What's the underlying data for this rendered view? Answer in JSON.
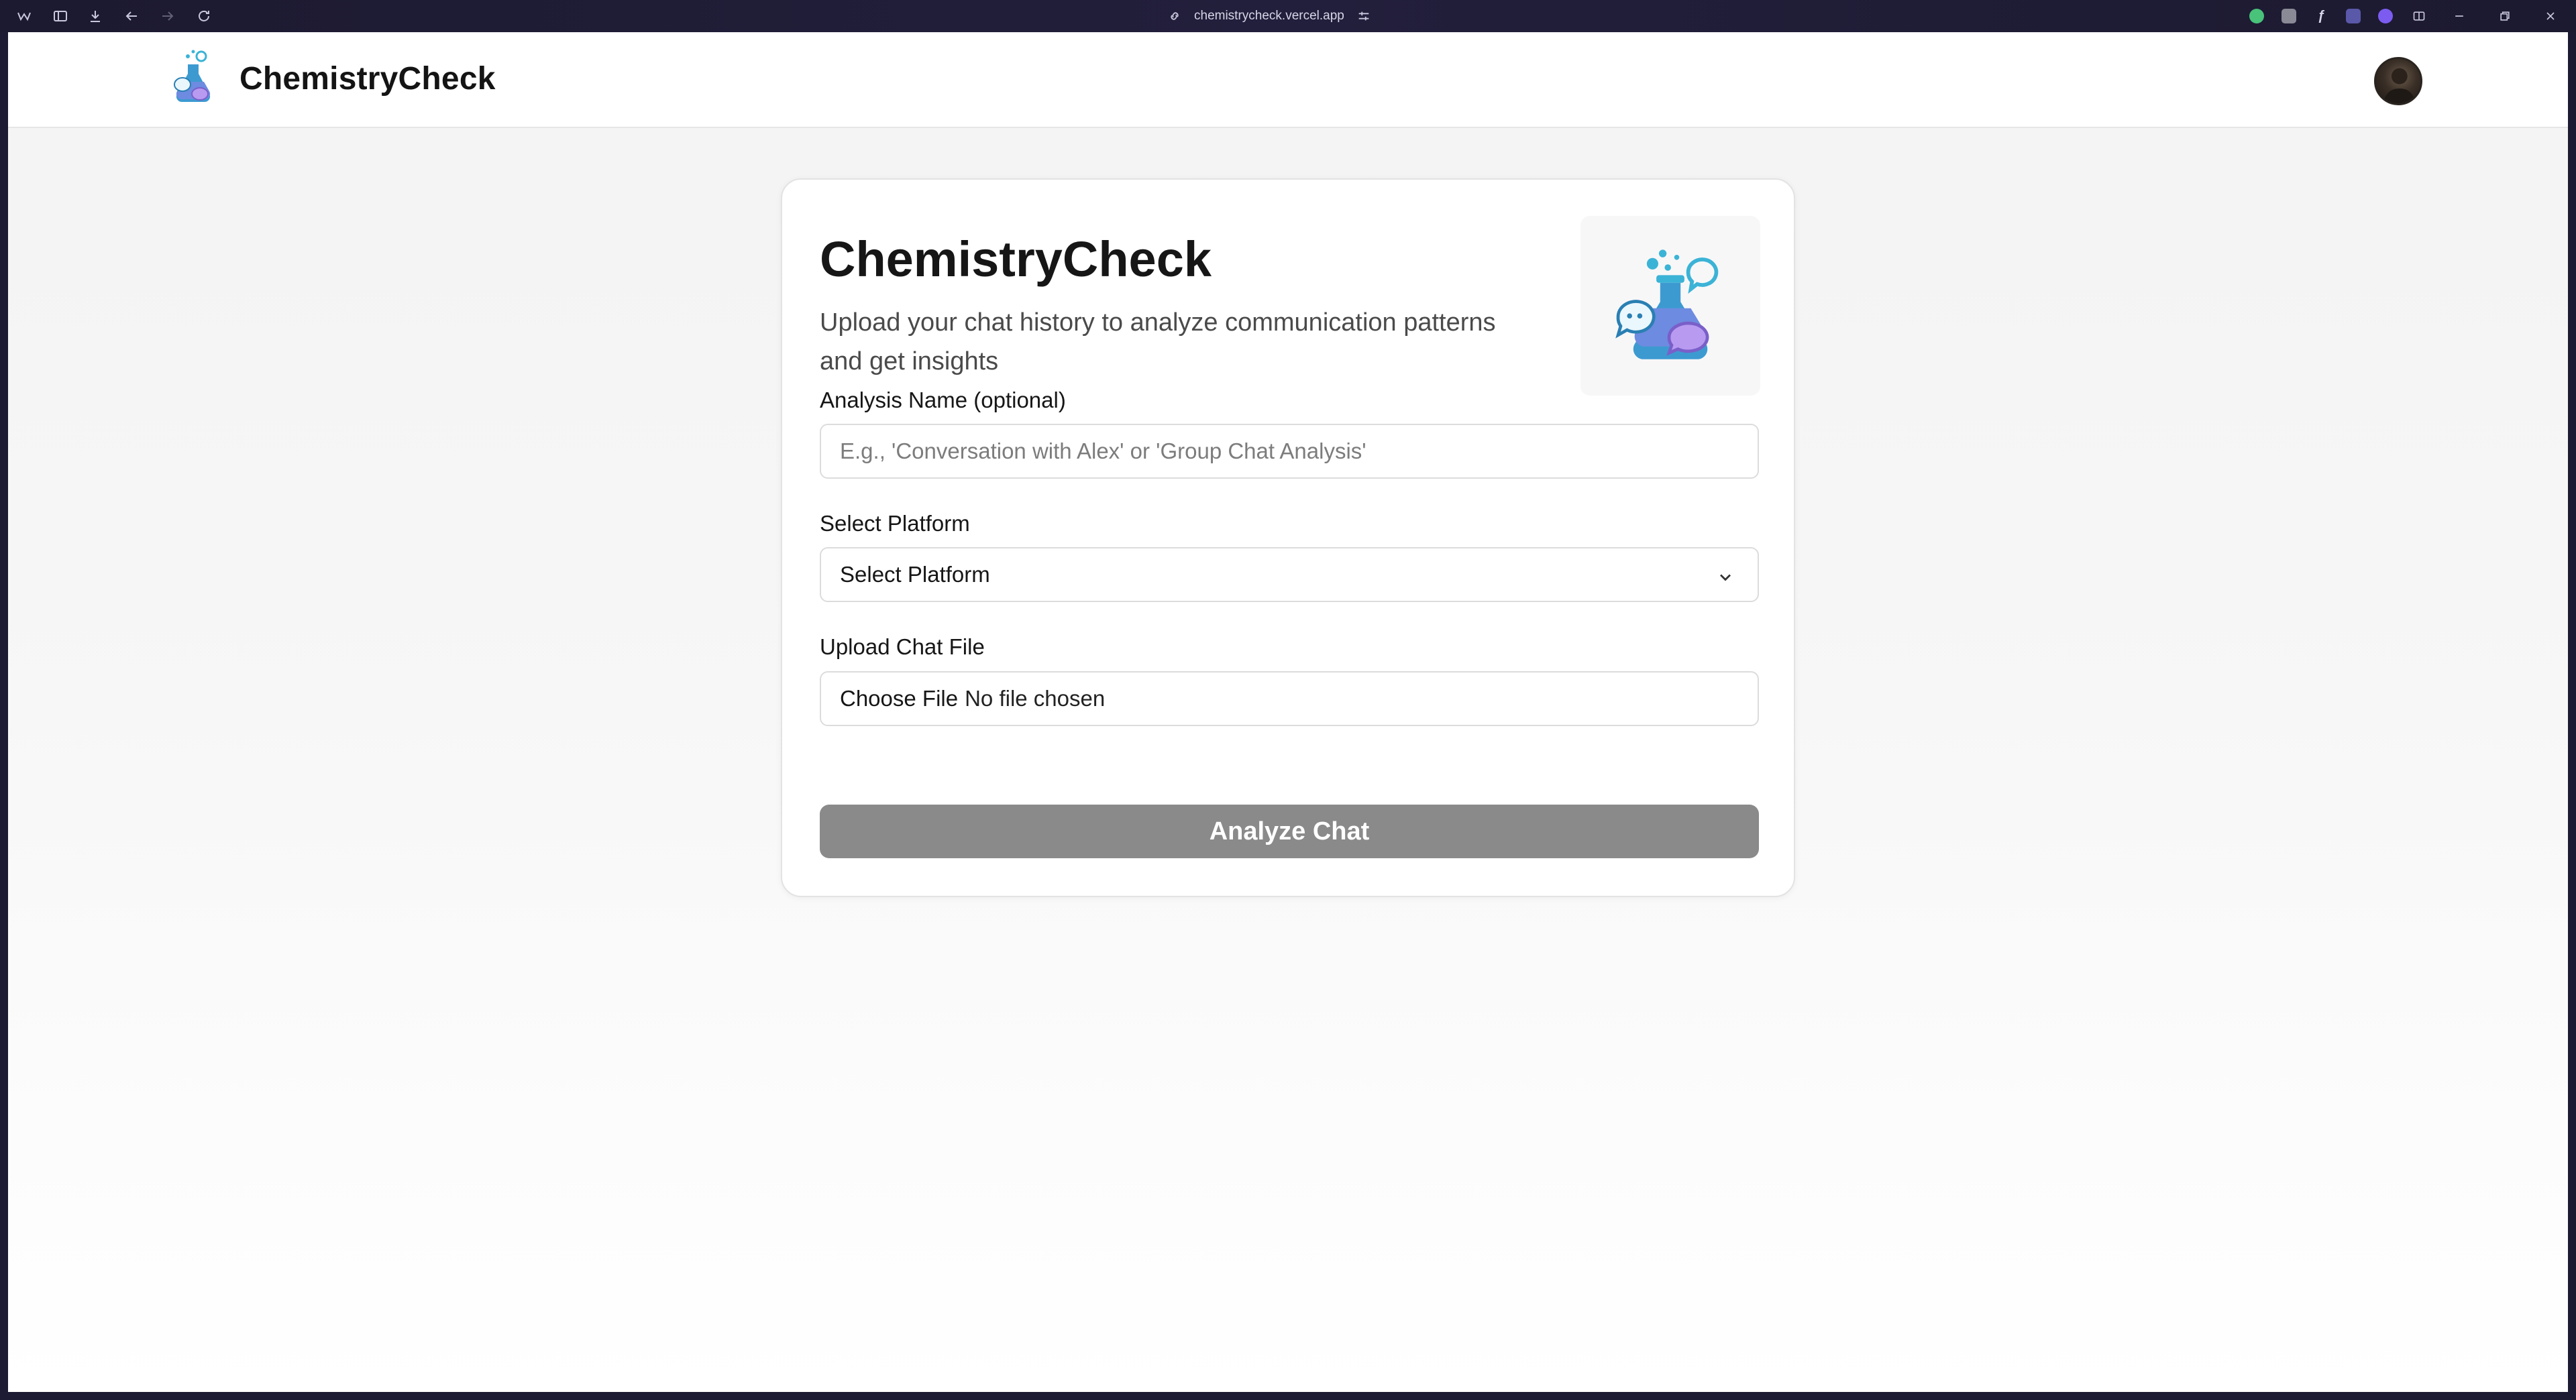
{
  "browser": {
    "url": "chemistrycheck.vercel.app"
  },
  "header": {
    "app_title": "ChemistryCheck",
    "logo_icon": "flask-chat-icon",
    "avatar_icon": "user-avatar"
  },
  "card": {
    "title": "ChemistryCheck",
    "subtitle": "Upload your chat history to analyze communication patterns and get insights",
    "illustration_icon": "flask-chat-icon"
  },
  "form": {
    "analysis_name": {
      "label": "Analysis Name (optional)",
      "value": "",
      "placeholder": "E.g., 'Conversation with Alex' or 'Group Chat Analysis'"
    },
    "platform": {
      "label": "Select Platform",
      "selected": "Select Platform"
    },
    "file": {
      "label": "Upload Chat File",
      "button_label": "Choose File",
      "status": "No file chosen"
    },
    "submit_label": "Analyze Chat"
  },
  "colors": {
    "submit_disabled_bg": "#8a8a8a",
    "flask_teal": "#3bb3d6",
    "flask_purple": "#9a7de6"
  }
}
